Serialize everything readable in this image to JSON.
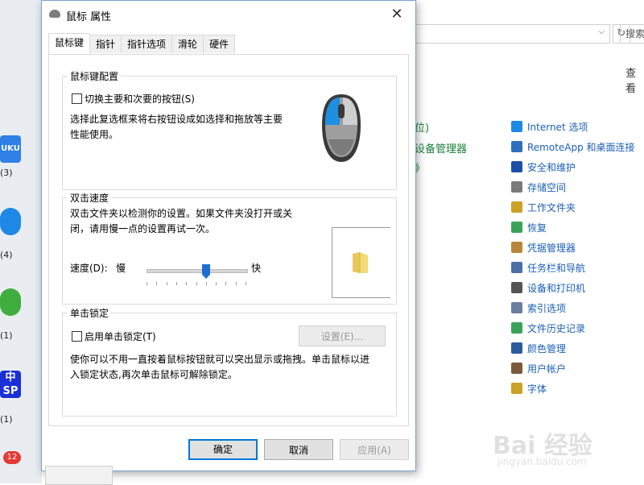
{
  "desktop": {
    "labels": [
      "(3)",
      "(4)",
      "(1)",
      "(1)"
    ],
    "badge": "12",
    "icon_text": [
      "UKU",
      "中",
      "SP"
    ]
  },
  "control_panel": {
    "search_placeholder": "搜索",
    "view_label": "查看",
    "left_fragments": [
      "位)",
      "设备管理器",
      "》"
    ],
    "items": [
      {
        "label": "Internet 选项",
        "icon": "globe-icon"
      },
      {
        "label": "RemoteApp 和桌面连接",
        "icon": "remote-icon"
      },
      {
        "label": "安全和维护",
        "icon": "flag-icon"
      },
      {
        "label": "存储空间",
        "icon": "storage-icon"
      },
      {
        "label": "工作文件夹",
        "icon": "folder-icon"
      },
      {
        "label": "恢复",
        "icon": "recovery-icon"
      },
      {
        "label": "凭据管理器",
        "icon": "credential-icon"
      },
      {
        "label": "任务栏和导航",
        "icon": "taskbar-icon"
      },
      {
        "label": "设备和打印机",
        "icon": "printer-icon"
      },
      {
        "label": "索引选项",
        "icon": "index-icon"
      },
      {
        "label": "文件历史记录",
        "icon": "history-icon"
      },
      {
        "label": "颜色管理",
        "icon": "color-icon"
      },
      {
        "label": "用户帐户",
        "icon": "users-icon"
      },
      {
        "label": "字体",
        "icon": "font-icon"
      }
    ],
    "colors": {
      "link": "#1a5fb4",
      "green_link": "#1a7f3a"
    }
  },
  "dialog": {
    "title": "鼠标 属性",
    "close_glyph": "✕",
    "tabs": [
      "鼠标键",
      "指针",
      "指针选项",
      "滑轮",
      "硬件"
    ],
    "active_tab": 0,
    "button_config": {
      "group_title": "鼠标键配置",
      "checkbox_label": "切换主要和次要的按钮(S)",
      "checked": false,
      "description": [
        "选择此复选框来将右按钮设成如选择和拖放等主要",
        "性能使用。"
      ]
    },
    "double_click": {
      "group_title": "双击速度",
      "description": [
        "双击文件夹以检测你的设置。如果文件夹没打开或关",
        "闭，请用慢一点的设置再试一次。"
      ],
      "speed_label": "速度(D):",
      "slow_label": "慢",
      "fast_label": "快",
      "slider_value_fraction": 0.6
    },
    "click_lock": {
      "group_title": "单击锁定",
      "checkbox_label": "启用单击锁定(T)",
      "checked": false,
      "settings_button": "设置(E)...",
      "description": [
        "使你可以不用一直按着鼠标按钮就可以突出显示或拖拽。单击鼠标以进",
        "入锁定状态,再次单击鼠标可解除锁定。"
      ]
    },
    "buttons": {
      "ok": "确定",
      "cancel": "取消",
      "apply": "应用(A)"
    }
  },
  "watermark": {
    "text": "Bai 经验",
    "sub": "jingyan.baidu.com"
  }
}
